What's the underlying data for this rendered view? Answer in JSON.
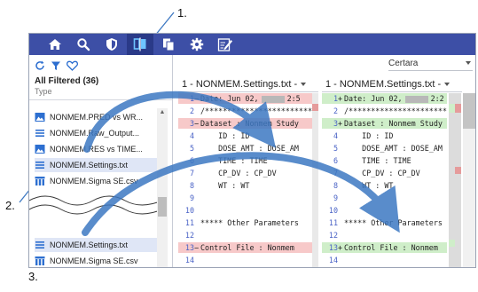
{
  "callouts": [
    "1.",
    "2.",
    "3."
  ],
  "toolbar": {
    "buttons": [
      {
        "icon": "home-icon"
      },
      {
        "icon": "search-icon"
      },
      {
        "icon": "shield-icon"
      },
      {
        "icon": "compare-icon",
        "active": true
      },
      {
        "icon": "copy-documents-icon"
      },
      {
        "icon": "gear-icon"
      },
      {
        "icon": "edit-note-icon"
      }
    ],
    "color": "#3d4fa6",
    "active_color": "#2a3a88"
  },
  "sidebar": {
    "tools": [
      "refresh-icon",
      "filter-icon",
      "favorite-heart-icon"
    ],
    "header": "All Filtered (36)",
    "subheader": "Type",
    "items": [
      {
        "label": "NONMEM.PRED vs WR...",
        "icon": "image-file-icon"
      },
      {
        "label": "NONMEM.Raw_Output...",
        "icon": "text-file-icon"
      },
      {
        "label": "NONMEM.RES vs TIME...",
        "icon": "image-file-icon"
      },
      {
        "label": "NONMEM.Settings.txt",
        "icon": "text-file-icon"
      },
      {
        "label": "NONMEM.Sigma SE.csv",
        "icon": "table-file-icon"
      },
      {
        "label": "NONMEM.Settings.txt",
        "icon": "text-file-icon"
      },
      {
        "label": "NONMEM.Sigma SE.csv",
        "icon": "table-file-icon"
      }
    ]
  },
  "vendor": {
    "selected": "Certara"
  },
  "left_pane": {
    "title": "1 - NONMEM.Settings.txt -",
    "lines": [
      {
        "n": "1",
        "mark": "−",
        "text": "Date: Jun 02,",
        "tail": "2:5",
        "state": "removed"
      },
      {
        "n": "2",
        "mark": "",
        "text": "/*****************************",
        "state": "normal"
      },
      {
        "n": "3",
        "mark": "−",
        "text": "Dataset : Nonmem Study",
        "state": "removed"
      },
      {
        "n": "4",
        "mark": "",
        "text": "    ID : ID",
        "state": "normal"
      },
      {
        "n": "5",
        "mark": "",
        "text": "    DOSE_AMT : DOSE_AM",
        "state": "normal"
      },
      {
        "n": "6",
        "mark": "",
        "text": "    TIME : TIME",
        "state": "normal"
      },
      {
        "n": "7",
        "mark": "",
        "text": "    CP_DV : CP_DV",
        "state": "normal"
      },
      {
        "n": "8",
        "mark": "",
        "text": "    WT : WT",
        "state": "normal"
      },
      {
        "n": "9",
        "mark": "",
        "text": "",
        "state": "normal"
      },
      {
        "n": "10",
        "mark": "",
        "text": "",
        "state": "normal"
      },
      {
        "n": "11",
        "mark": "",
        "text": "***** Other Parameters",
        "state": "normal"
      },
      {
        "n": "12",
        "mark": "",
        "text": "",
        "state": "normal"
      },
      {
        "n": "13",
        "mark": "−",
        "text": "Control File : Nonmem",
        "state": "removed"
      },
      {
        "n": "14",
        "mark": "",
        "text": "",
        "state": "normal"
      }
    ]
  },
  "right_pane": {
    "title": "1 - NONMEM.Settings.txt -",
    "lines": [
      {
        "n": "1",
        "mark": "+",
        "text": "Date: Jun 02,",
        "tail": "2:2",
        "state": "added"
      },
      {
        "n": "2",
        "mark": "",
        "text": "/*****************************",
        "state": "normal"
      },
      {
        "n": "3",
        "mark": "+",
        "text": "Dataset : Nonmem Study",
        "state": "added"
      },
      {
        "n": "4",
        "mark": "",
        "text": "    ID : ID",
        "state": "normal"
      },
      {
        "n": "5",
        "mark": "",
        "text": "    DOSE_AMT : DOSE_AM",
        "state": "normal"
      },
      {
        "n": "6",
        "mark": "",
        "text": "    TIME : TIME",
        "state": "normal"
      },
      {
        "n": "7",
        "mark": "",
        "text": "    CP_DV : CP_DV",
        "state": "normal"
      },
      {
        "n": "8",
        "mark": "",
        "text": "    WT : WT",
        "state": "normal"
      },
      {
        "n": "9",
        "mark": "",
        "text": "",
        "state": "normal"
      },
      {
        "n": "10",
        "mark": "",
        "text": "",
        "state": "normal"
      },
      {
        "n": "11",
        "mark": "",
        "text": "***** Other Parameters",
        "state": "normal"
      },
      {
        "n": "12",
        "mark": "",
        "text": "",
        "state": "normal"
      },
      {
        "n": "13",
        "mark": "+",
        "text": "Control File : Nonmem",
        "state": "added"
      },
      {
        "n": "14",
        "mark": "",
        "text": "",
        "state": "normal"
      }
    ]
  },
  "colors": {
    "removed": "#f7c9c9",
    "added": "#cfeec9",
    "arrow": "#3d78c2",
    "removed_marker": "#e59b9b",
    "added_marker": "#a7d99c"
  }
}
